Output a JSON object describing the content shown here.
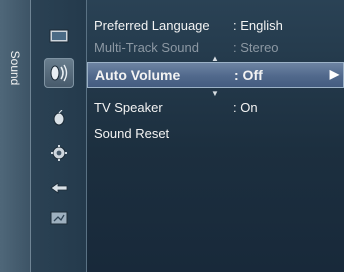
{
  "sidebar": {
    "tab_label": "Sound"
  },
  "icons": [
    {
      "name": "picture-icon"
    },
    {
      "name": "sound-icon"
    },
    {
      "name": "channel-icon"
    },
    {
      "name": "setup-icon"
    },
    {
      "name": "input-icon"
    },
    {
      "name": "application-icon"
    }
  ],
  "menu": {
    "items": [
      {
        "label": "Preferred Language",
        "value": ": English",
        "state": "normal"
      },
      {
        "label": "Multi-Track Sound",
        "value": ": Stereo",
        "state": "disabled"
      },
      {
        "label": "Auto Volume",
        "value": ": Off",
        "state": "selected"
      },
      {
        "label": "TV Speaker",
        "value": ": On",
        "state": "normal"
      },
      {
        "label": "Sound Reset",
        "value": "",
        "state": "normal"
      }
    ],
    "arrow_glyph": "▶",
    "up_glyph": "▲",
    "down_glyph": "▼"
  }
}
